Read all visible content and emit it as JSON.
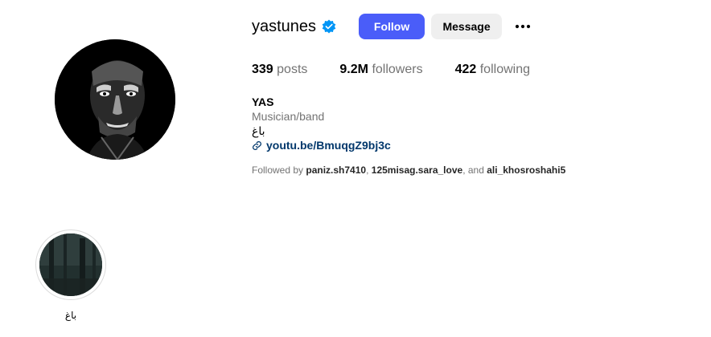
{
  "profile": {
    "username": "yastunes",
    "follow_label": "Follow",
    "message_label": "Message",
    "more_icon": "more-horizontal-icon",
    "verified_icon": "verified-badge-icon"
  },
  "stats": {
    "posts_count": "339",
    "posts_label": "posts",
    "followers_count": "9.2M",
    "followers_label": "followers",
    "following_count": "422",
    "following_label": "following"
  },
  "bio": {
    "name": "YAS",
    "category": "Musician/band",
    "text": "باغ",
    "link_icon": "link-icon",
    "link": "youtu.be/BmuqgZ9bj3c"
  },
  "followed_by": {
    "prefix": "Followed by",
    "user1": "paniz.sh7410",
    "sep1": ",",
    "user2": "125misag.sara_love",
    "sep2": ", and",
    "user3": "ali_khosroshahi5"
  },
  "highlights": [
    {
      "label": "باغ"
    }
  ],
  "colors": {
    "follow_button": "#4a5df9",
    "message_button": "#efefef",
    "verified": "#0095f6",
    "link": "#00376b",
    "secondary_text": "#737373"
  }
}
